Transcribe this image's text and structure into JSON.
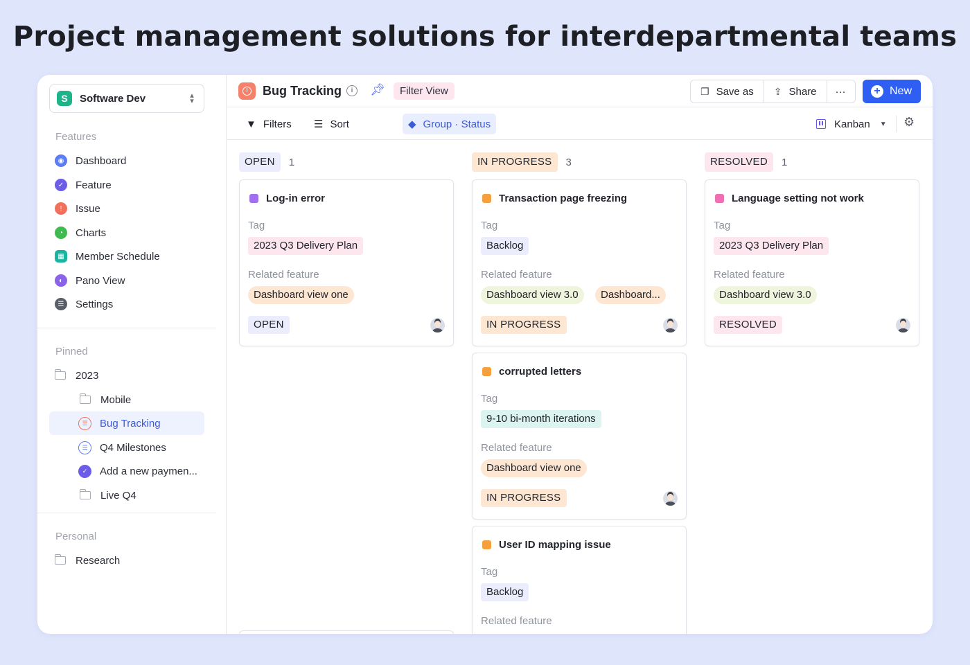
{
  "hero": {
    "title": "Project management solutions for interdepartmental teams"
  },
  "workspace": {
    "logo_letter": "S",
    "name": "Software Dev"
  },
  "sidebar": {
    "features_label": "Features",
    "features": [
      {
        "label": "Dashboard",
        "icon": "dashboard-icon",
        "color": "#5b7cf5"
      },
      {
        "label": "Feature",
        "icon": "feature-icon",
        "color": "#6c5ce7"
      },
      {
        "label": "Issue",
        "icon": "issue-icon",
        "color": "#f2705b"
      },
      {
        "label": "Charts",
        "icon": "charts-icon",
        "color": "#3dbb4e"
      },
      {
        "label": "Member Schedule",
        "icon": "schedule-icon",
        "color": "#19b5a0"
      },
      {
        "label": "Pano View",
        "icon": "pano-icon",
        "color": "#8a63e6"
      },
      {
        "label": "Settings",
        "icon": "settings-icon",
        "color": "#5a5e68"
      }
    ],
    "pinned_label": "Pinned",
    "pinned": {
      "folder_2023": "2023",
      "folder_mobile": "Mobile",
      "bug_tracking": "Bug Tracking",
      "q4_milestones": "Q4 Milestones",
      "add_payment": "Add a new paymen...",
      "folder_live_q4": "Live Q4"
    },
    "personal_label": "Personal",
    "personal": {
      "research": "Research"
    }
  },
  "topbar": {
    "title": "Bug Tracking",
    "filter_view": "Filter View",
    "save_as": "Save as",
    "share": "Share",
    "more": "···",
    "new": "New"
  },
  "toolbar": {
    "filters": "Filters",
    "sort": "Sort",
    "group": "Group · Status",
    "view": "Kanban"
  },
  "colors": {
    "accent": "#2f5ff2",
    "open_bg": "#ebedfd",
    "progress_bg": "#fde6d2",
    "resolved_bg": "#fde6ee",
    "tag_pink": "#fde6ee",
    "tag_lavender": "#ebedfd",
    "tag_teal": "#dcf4ef",
    "feature_orange": "#fde6d2",
    "feature_green": "#eef5dc"
  },
  "board": {
    "field_tag": "Tag",
    "field_related": "Related feature",
    "columns": [
      {
        "name": "OPEN",
        "count": "1",
        "cards": [
          {
            "title": "Log-in error",
            "dot": "#a070f0",
            "tag": "2023 Q3 Delivery Plan",
            "features": [
              "Dashboard view one"
            ],
            "status": "OPEN"
          }
        ]
      },
      {
        "name": "IN PROGRESS",
        "count": "3",
        "cards": [
          {
            "title": "Transaction page freezing",
            "dot": "#f5a03c",
            "tag": "Backlog",
            "features": [
              "Dashboard view 3.0",
              "Dashboard..."
            ],
            "status": "IN PROGRESS"
          },
          {
            "title": "corrupted letters",
            "dot": "#f5a03c",
            "tag": "9-10 bi-month iterations",
            "features": [
              "Dashboard view one"
            ],
            "status": "IN PROGRESS"
          },
          {
            "title": "User ID mapping issue",
            "dot": "#f5a03c",
            "tag": "Backlog",
            "features": [],
            "status": ""
          }
        ]
      },
      {
        "name": "RESOLVED",
        "count": "1",
        "cards": [
          {
            "title": "Language setting not work",
            "dot": "#f06fb4",
            "tag": "2023 Q3 Delivery Plan",
            "features": [
              "Dashboard view 3.0"
            ],
            "status": "RESOLVED"
          }
        ]
      }
    ]
  }
}
